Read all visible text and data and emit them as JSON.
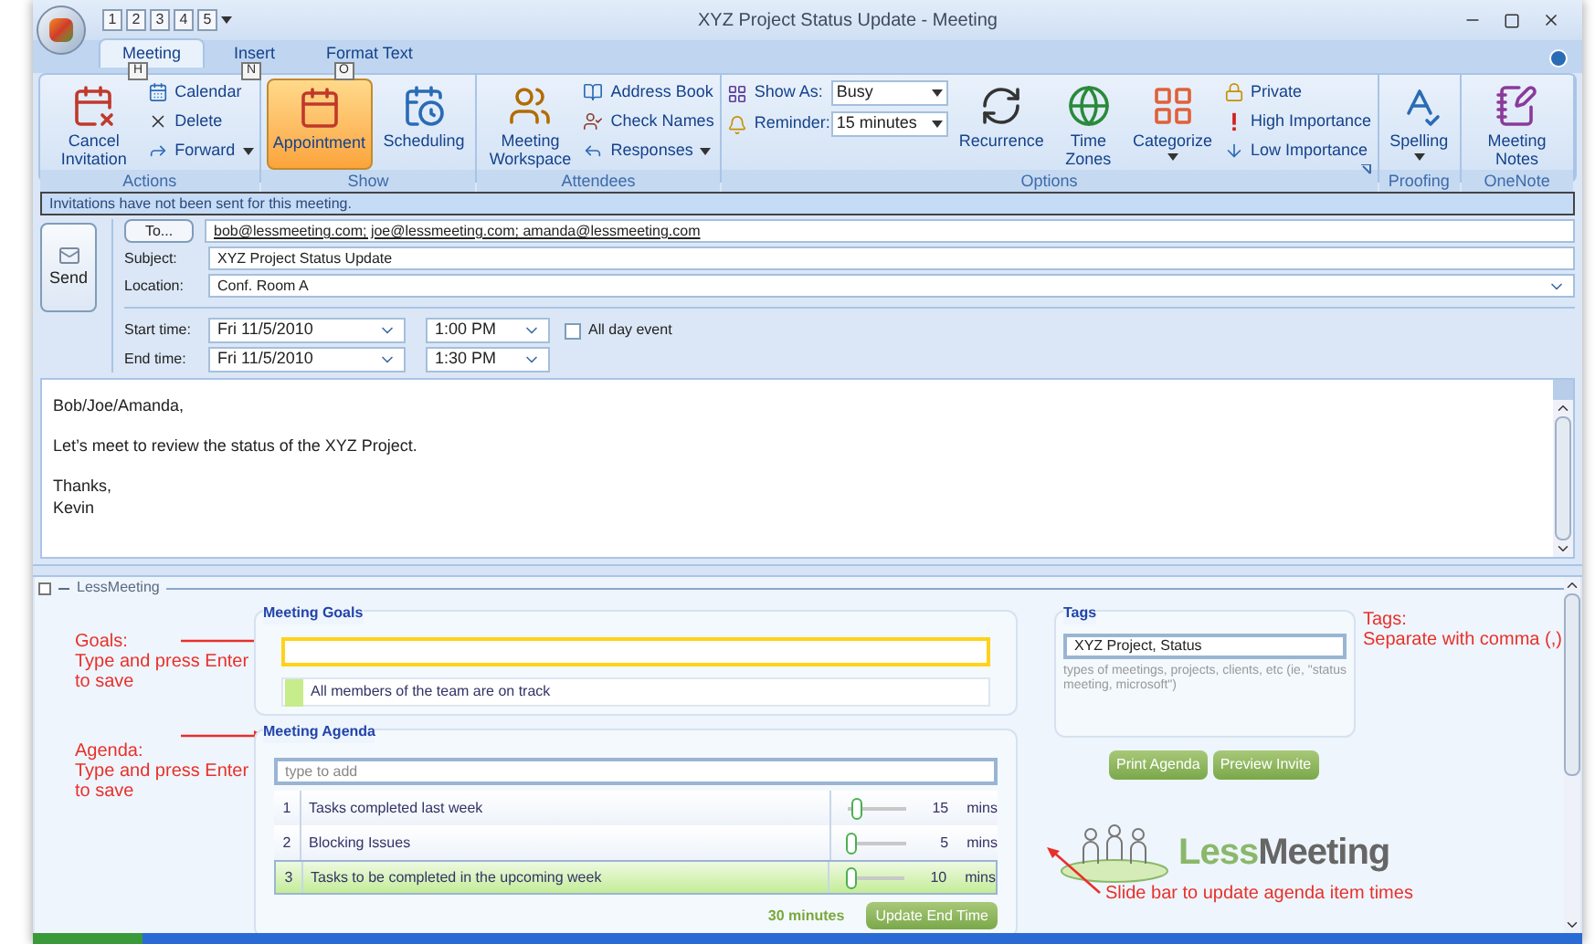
{
  "window": {
    "title": "XYZ Project Status Update - Meeting"
  },
  "quick_access": [
    "1",
    "2",
    "3",
    "4",
    "5"
  ],
  "tabs": [
    {
      "label": "Meeting",
      "key_tip": "H",
      "selected": true
    },
    {
      "label": "Insert",
      "key_tip": "N",
      "selected": false
    },
    {
      "label": "Format Text",
      "key_tip": "O",
      "selected": false
    }
  ],
  "ribbon": [
    {
      "label": "Actions",
      "columns": [
        [
          {
            "kind": "large",
            "label": "Cancel Invitation",
            "menu": false,
            "pressed": false
          }
        ],
        [
          {
            "kind": "small",
            "label": "Calendar",
            "menu": false,
            "pressed": false
          },
          {
            "kind": "small",
            "label": "Delete",
            "menu": false,
            "pressed": false
          },
          {
            "kind": "small",
            "label": "Forward",
            "menu": true,
            "pressed": false
          }
        ]
      ]
    },
    {
      "label": "Show",
      "columns": [
        [
          {
            "kind": "large",
            "label": "Appointment",
            "menu": false,
            "pressed": true
          }
        ],
        [
          {
            "kind": "large",
            "label": "Scheduling",
            "menu": false,
            "pressed": false
          }
        ]
      ]
    },
    {
      "label": "Attendees",
      "columns": [
        [
          {
            "kind": "large",
            "label": "Meeting Workspace",
            "menu": false,
            "pressed": false
          }
        ],
        [
          {
            "kind": "small",
            "label": "Address Book",
            "menu": false,
            "pressed": false
          },
          {
            "kind": "small",
            "label": "Check Names",
            "menu": false,
            "pressed": false
          },
          {
            "kind": "small",
            "label": "Responses",
            "menu": true,
            "pressed": false
          }
        ]
      ]
    },
    {
      "label": "Options",
      "columns": [
        [
          {
            "kind": "select",
            "label": "Show As:",
            "value": "Busy",
            "menu": true
          },
          {
            "kind": "select",
            "label": "Reminder:",
            "value": "15 minutes",
            "menu": true
          }
        ],
        [
          {
            "kind": "large",
            "label": "Recurrence",
            "menu": false,
            "pressed": false
          }
        ],
        [
          {
            "kind": "large",
            "label": "Time Zones",
            "menu": false,
            "pressed": false
          }
        ],
        [
          {
            "kind": "large",
            "label": "Categorize",
            "menu": true,
            "pressed": false
          }
        ],
        [
          {
            "kind": "small",
            "label": "Private",
            "menu": false,
            "pressed": false
          },
          {
            "kind": "small",
            "label": "High Importance",
            "menu": false,
            "pressed": false
          },
          {
            "kind": "small",
            "label": "Low Importance",
            "menu": false,
            "pressed": false
          }
        ]
      ]
    },
    {
      "label": "Proofing",
      "columns": [
        [
          {
            "kind": "large",
            "label": "Spelling",
            "menu": true,
            "pressed": false
          }
        ]
      ]
    },
    {
      "label": "OneNote",
      "columns": [
        [
          {
            "kind": "large",
            "label": "Meeting Notes",
            "menu": false,
            "pressed": false
          }
        ]
      ]
    }
  ],
  "info_bar": "Invitations have not been sent for this meeting.",
  "message": {
    "send": "Send",
    "to": {
      "button": "To...",
      "value": "bob@lessmeeting.com; joe@lessmeeting.com; amanda@lessmeeting.com"
    },
    "fields": [
      {
        "label": "Subject:",
        "value": "XYZ Project Status Update",
        "menu": false
      },
      {
        "label": "Location:",
        "value": "Conf. Room A",
        "menu": true
      }
    ],
    "times": [
      {
        "label": "Start time:",
        "date": "Fri 11/5/2010",
        "time": "1:00 PM"
      },
      {
        "label": "End time:",
        "date": "Fri 11/5/2010",
        "time": "1:30 PM"
      }
    ],
    "all_day": {
      "label": "All day event",
      "checked": false
    },
    "body": [
      [
        "Bob/Joe/Amanda,"
      ],
      [
        "Let’s meet to review the status of the XYZ Project."
      ],
      [
        "Thanks,",
        "Kevin"
      ]
    ]
  },
  "less_meeting": {
    "header": "LessMeeting",
    "goals": {
      "title": "Meeting Goals",
      "items": [
        "All members of the team are on track"
      ]
    },
    "agenda": {
      "title": "Meeting Agenda",
      "placeholder": "type to add",
      "items": [
        {
          "number": "1",
          "text": "Tasks completed last week",
          "level": 0.15,
          "duration": "15",
          "unit": "mins",
          "selected": false
        },
        {
          "number": "2",
          "text": "Blocking Issues",
          "level": 0.05,
          "duration": "5",
          "unit": "mins",
          "selected": false
        },
        {
          "number": "3",
          "text": "Tasks to be completed in the upcoming week",
          "level": 0.1,
          "duration": "10",
          "unit": "mins",
          "selected": true
        }
      ],
      "total": "30 minutes",
      "update_button": "Update End Time"
    },
    "tags": {
      "title": "Tags",
      "value": "XYZ Project, Status",
      "hint": "types of meetings, projects, clients, etc (ie, \"status meeting, microsoft\")"
    },
    "buttons": [
      "Print Agenda",
      "Preview Invite"
    ],
    "logo": {
      "first": "Less",
      "second": "Meeting"
    }
  },
  "annotations": {
    "goals": {
      "title": "Goals:",
      "text": "Type and press Enter to save"
    },
    "agenda": {
      "title": "Agenda:",
      "text": "Type and press Enter to save"
    },
    "tags": {
      "title": "Tags:",
      "text": "Separate with comma (,)"
    },
    "slider": {
      "text": "Slide bar to update agenda item times"
    }
  }
}
